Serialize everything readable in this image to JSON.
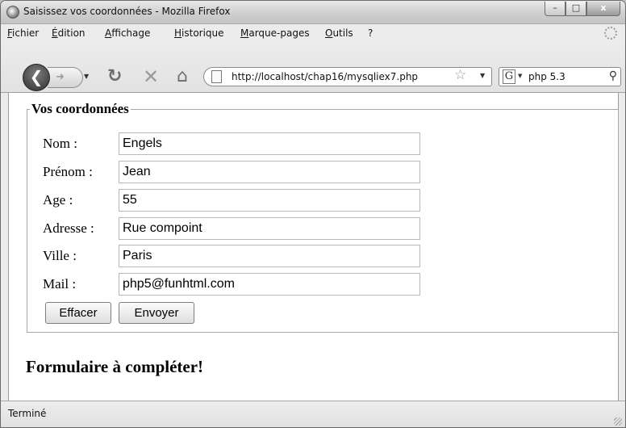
{
  "window": {
    "title": "Saisissez vos coordonnées - Mozilla Firefox",
    "minimize_label": "–",
    "maximize_label": "□",
    "close_label": "x"
  },
  "menubar": {
    "items": [
      {
        "label": "Fichier"
      },
      {
        "label": "Édition"
      },
      {
        "label": "Affichage"
      },
      {
        "label": "Historique"
      },
      {
        "label": "Marque-pages"
      },
      {
        "label": "Outils"
      },
      {
        "label": "?"
      }
    ]
  },
  "navbar": {
    "url": "http://localhost/chap16/mysqliex7.php",
    "search_engine_letter": "G",
    "search_value": "php 5.3",
    "icons": [
      "back-icon",
      "forward-icon",
      "reload-icon",
      "stop-icon",
      "home-icon",
      "page-icon",
      "star-icon",
      "search-icon"
    ]
  },
  "form": {
    "legend": "Vos coordonnées",
    "fields": [
      {
        "label": "Nom :",
        "value": "Engels"
      },
      {
        "label": "Prénom :",
        "value": "Jean"
      },
      {
        "label": "Age :",
        "value": "55"
      },
      {
        "label": "Adresse :",
        "value": "Rue compoint"
      },
      {
        "label": "Ville :",
        "value": "Paris"
      },
      {
        "label": "Mail :",
        "value": "php5@funhtml.com"
      }
    ],
    "reset_label": "Effacer",
    "submit_label": "Envoyer"
  },
  "page": {
    "caption": "Formulaire à compléter!"
  },
  "status": {
    "text": "Terminé"
  }
}
